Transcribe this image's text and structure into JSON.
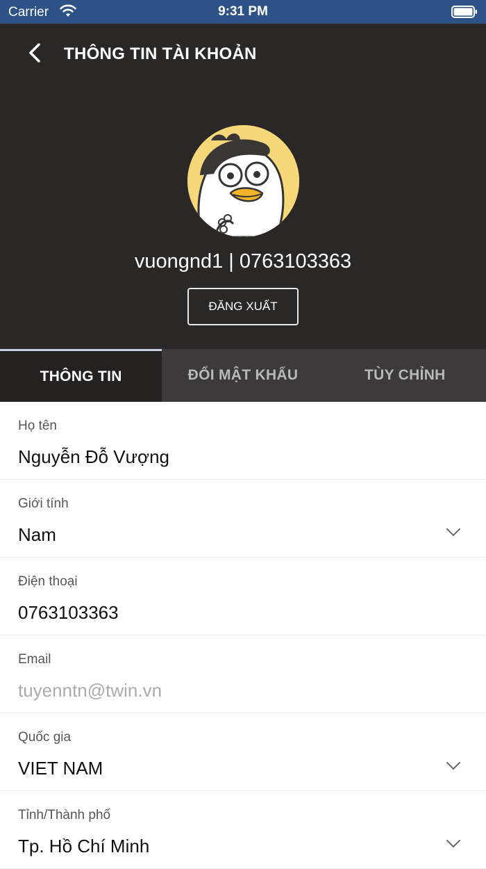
{
  "status_bar": {
    "carrier": "Carrier",
    "time": "9:31 PM"
  },
  "header": {
    "title": "THÔNG TIN TÀI KHOẢN",
    "user_line": "vuongnd1 | 0763103363",
    "logout_label": "ĐĂNG XUẤT"
  },
  "tabs": [
    {
      "label": "THÔNG TIN",
      "active": true
    },
    {
      "label": "ĐỔI MẬT KHẨU",
      "active": false
    },
    {
      "label": "TÙY CHỈNH",
      "active": false
    }
  ],
  "form": {
    "full_name": {
      "label": "Họ tên",
      "value": "Nguyễn Đỗ Vượng"
    },
    "gender": {
      "label": "Giới tính",
      "value": "Nam"
    },
    "phone": {
      "label": "Điện thoại",
      "value": "0763103363"
    },
    "email": {
      "label": "Email",
      "value": "tuyenntn@twin.vn"
    },
    "country": {
      "label": "Quốc gia",
      "value": "VIET NAM"
    },
    "city": {
      "label": "Tỉnh/Thành phố",
      "value": "Tp. Hồ Chí Minh"
    }
  },
  "colors": {
    "status_bar": "#2d5285",
    "header_bg": "#2a2727",
    "tab_bg": "#3c3a3a",
    "tab_active_bg": "#242121"
  },
  "icons": [
    "wifi-icon",
    "battery-icon",
    "back-arrow-icon",
    "chevron-down-icon"
  ]
}
